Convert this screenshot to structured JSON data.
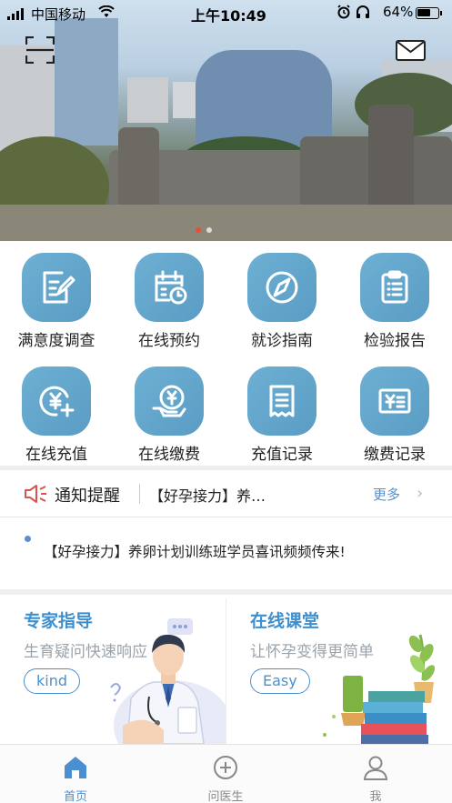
{
  "status_bar": {
    "carrier": "中国移动",
    "time": "上午10:49",
    "battery": "64%"
  },
  "hero": {
    "icons": [
      "scan-icon",
      "mail-icon"
    ]
  },
  "grid": [
    {
      "label": "满意度调查",
      "icon": "survey-icon"
    },
    {
      "label": "在线预约",
      "icon": "calendar-icon"
    },
    {
      "label": "就诊指南",
      "icon": "compass-icon"
    },
    {
      "label": "检验报告",
      "icon": "clipboard-icon"
    },
    {
      "label": "在线充值",
      "icon": "recharge-icon"
    },
    {
      "label": "在线缴费",
      "icon": "payment-icon"
    },
    {
      "label": "充值记录",
      "icon": "receipt-icon"
    },
    {
      "label": "缴费记录",
      "icon": "bill-record-icon"
    }
  ],
  "notice": {
    "title": "通知提醒",
    "snippet": "【好孕接力】养…",
    "more": "更多"
  },
  "news": {
    "text": "【好孕接力】养卵计划训练班学员喜讯频频传来!"
  },
  "cards": [
    {
      "title": "专家指导",
      "subtitle": "生育疑问快速响应",
      "button": "kind"
    },
    {
      "title": "在线课堂",
      "subtitle": "让怀孕变得更简单",
      "button": "Easy"
    }
  ],
  "tabbar": [
    {
      "label": "首页",
      "icon": "home-icon",
      "active": true
    },
    {
      "label": "问医生",
      "icon": "plus-circle-icon",
      "active": false
    },
    {
      "label": "我",
      "icon": "user-icon",
      "active": false
    }
  ],
  "colors": {
    "accent": "#4a90d0",
    "icon_bg": "#5a9cc4",
    "notice_icon": "#d9534f"
  }
}
